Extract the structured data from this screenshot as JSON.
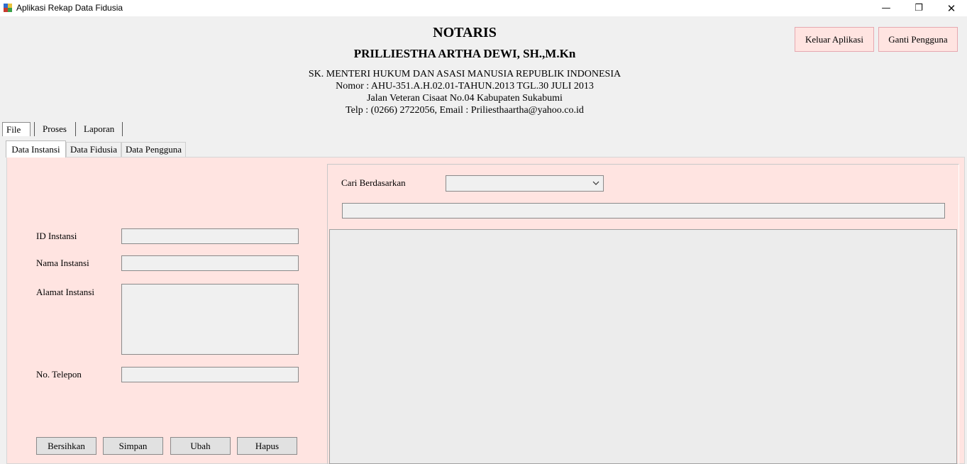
{
  "window": {
    "title": "Aplikasi Rekap Data Fidusia",
    "minimize_glyph": "—",
    "maximize_glyph": "❐",
    "close_glyph": "✕"
  },
  "header": {
    "title": "NOTARIS",
    "name": "PRILLIESTHA ARTHA DEWI, SH.,M.Kn",
    "lines": [
      "SK. MENTERI HUKUM DAN ASASI MANUSIA REPUBLIK INDONESIA",
      "Nomor : AHU-351.A.H.02.01-TAHUN.2013 TGL.30 JULI 2013",
      "Jalan Veteran Cisaat No.04 Kabupaten Sukabumi",
      "Telp : (0266) 2722056, Email : Priliesthaartha@yahoo.co.id"
    ]
  },
  "top_buttons": {
    "keluar": "Keluar Aplikasi",
    "ganti": "Ganti Pengguna"
  },
  "menu": [
    "File",
    "Proses",
    "Laporan"
  ],
  "tabs": [
    "Data Instansi",
    "Data Fidusia",
    "Data Pengguna"
  ],
  "form": {
    "id_label": "ID Instansi",
    "id_value": "",
    "nama_label": "Nama Instansi",
    "nama_value": "",
    "alamat_label": "Alamat Instansi",
    "alamat_value": "",
    "telp_label": "No. Telepon",
    "telp_value": ""
  },
  "actions": [
    "Bersihkan",
    "Simpan",
    "Ubah",
    "Hapus"
  ],
  "search": {
    "label": "Cari Berdasarkan",
    "selected": "",
    "query": ""
  },
  "colors": {
    "panel_bg": "#ffe4e1",
    "window_bg": "#f0f0f0"
  },
  "icons": {
    "app": "app-icon",
    "dropdown": "chevron-down-icon"
  }
}
